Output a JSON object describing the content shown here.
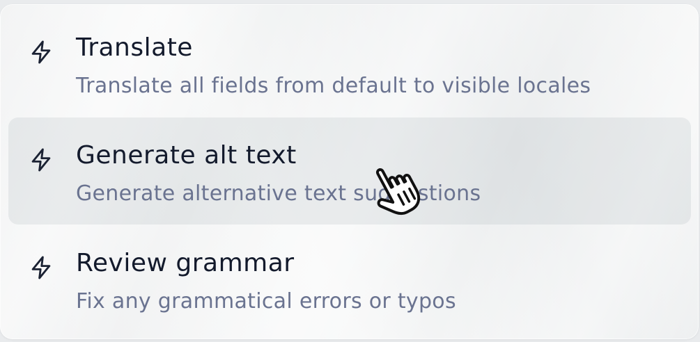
{
  "menu": {
    "items": [
      {
        "icon": "lightning-bolt-icon",
        "title": "Translate",
        "description": "Translate all fields from default to visible locales"
      },
      {
        "icon": "lightning-bolt-icon",
        "title": "Generate alt text",
        "description": "Generate alternative text suggestions",
        "state": "hovered"
      },
      {
        "icon": "lightning-bolt-icon",
        "title": "Review grammar",
        "description": "Fix any grammatical errors or typos"
      }
    ]
  },
  "cursor": {
    "icon": "hand-pointer-cursor-icon"
  },
  "colors": {
    "title": "#131a2c",
    "description": "#6a7390",
    "hover_background": "#e1e4e8"
  }
}
